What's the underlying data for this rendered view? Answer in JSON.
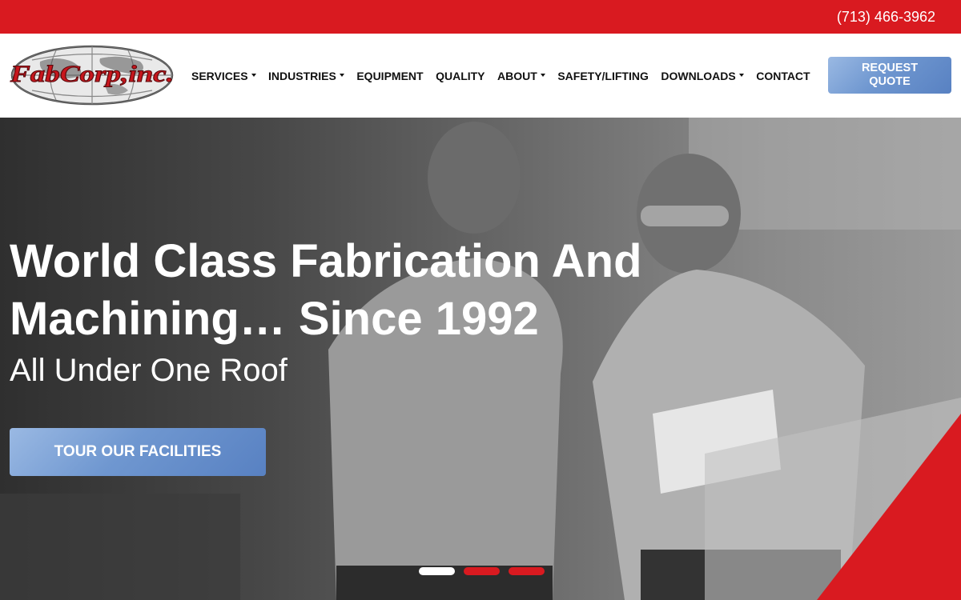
{
  "topbar": {
    "phone": "(713) 466-3962",
    "color": "#d91a20"
  },
  "logo": {
    "text": "FabCorp,inc.",
    "color": "#c8161d"
  },
  "nav": {
    "items": [
      {
        "label": "SERVICES",
        "dropdown": true
      },
      {
        "label": "INDUSTRIES",
        "dropdown": true
      },
      {
        "label": "EQUIPMENT",
        "dropdown": false
      },
      {
        "label": "QUALITY",
        "dropdown": false
      },
      {
        "label": "ABOUT",
        "dropdown": true
      },
      {
        "label": "SAFETY/LIFTING",
        "dropdown": false
      },
      {
        "label": "DOWNLOADS",
        "dropdown": true
      },
      {
        "label": "CONTACT",
        "dropdown": false
      }
    ],
    "cta_line1": "REQUEST",
    "cta_line2": "QUOTE"
  },
  "hero": {
    "title_line1": "World Class Fabrication And",
    "title_line2": "Machining… Since 1992",
    "subtitle": "All Under One Roof",
    "cta": "TOUR OUR FACILITIES",
    "slides": 3,
    "active_slide": 1,
    "accent": "#d91a20",
    "button_color": "#6f97d0"
  }
}
